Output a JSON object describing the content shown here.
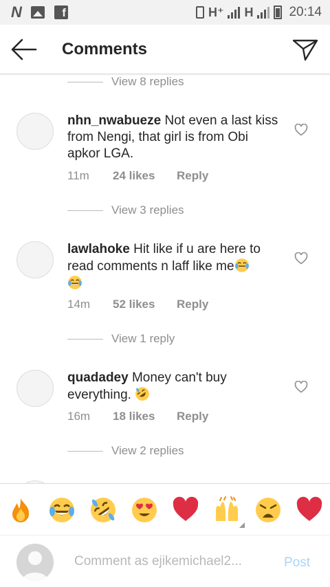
{
  "status_bar": {
    "left_icons": [
      "n-app-icon",
      "gallery-icon",
      "facebook-icon"
    ],
    "network_1": "H⁺",
    "network_2": "H",
    "time": "20:14"
  },
  "header": {
    "title": "Comments"
  },
  "thread": {
    "top_view_replies": "View 8 replies",
    "comments": [
      {
        "username": "nhn_nwabueze",
        "text": "Not even a last kiss from Nengi, that girl is from Obi apkor LGA.",
        "time": "11m",
        "likes": "24 likes",
        "reply_label": "Reply",
        "view_replies": "View 3 replies"
      },
      {
        "username": "lawlahoke",
        "text": "Hit like if u are here to read comments n laff like me",
        "time": "14m",
        "likes": "52 likes",
        "reply_label": "Reply",
        "view_replies": "View 1 reply"
      },
      {
        "username": "quadadey",
        "text": "Money can't buy everything.",
        "time": "16m",
        "likes": "18 likes",
        "reply_label": "Reply",
        "view_replies": "View 2 replies"
      }
    ]
  },
  "emoji_bar": [
    "fire-emoji",
    "joy-emoji",
    "rofl-emoji",
    "heart-eyes-emoji",
    "red-heart-emoji",
    "raised-hands-emoji",
    "weary-emoji",
    "red-heart-emoji"
  ],
  "compose": {
    "placeholder": "Comment as ejikemichael2...",
    "post_label": "Post"
  },
  "colors": {
    "muted_text": "#8e8e8e",
    "post_disabled": "#a9d5f5",
    "heart_red": "#ed4956"
  }
}
